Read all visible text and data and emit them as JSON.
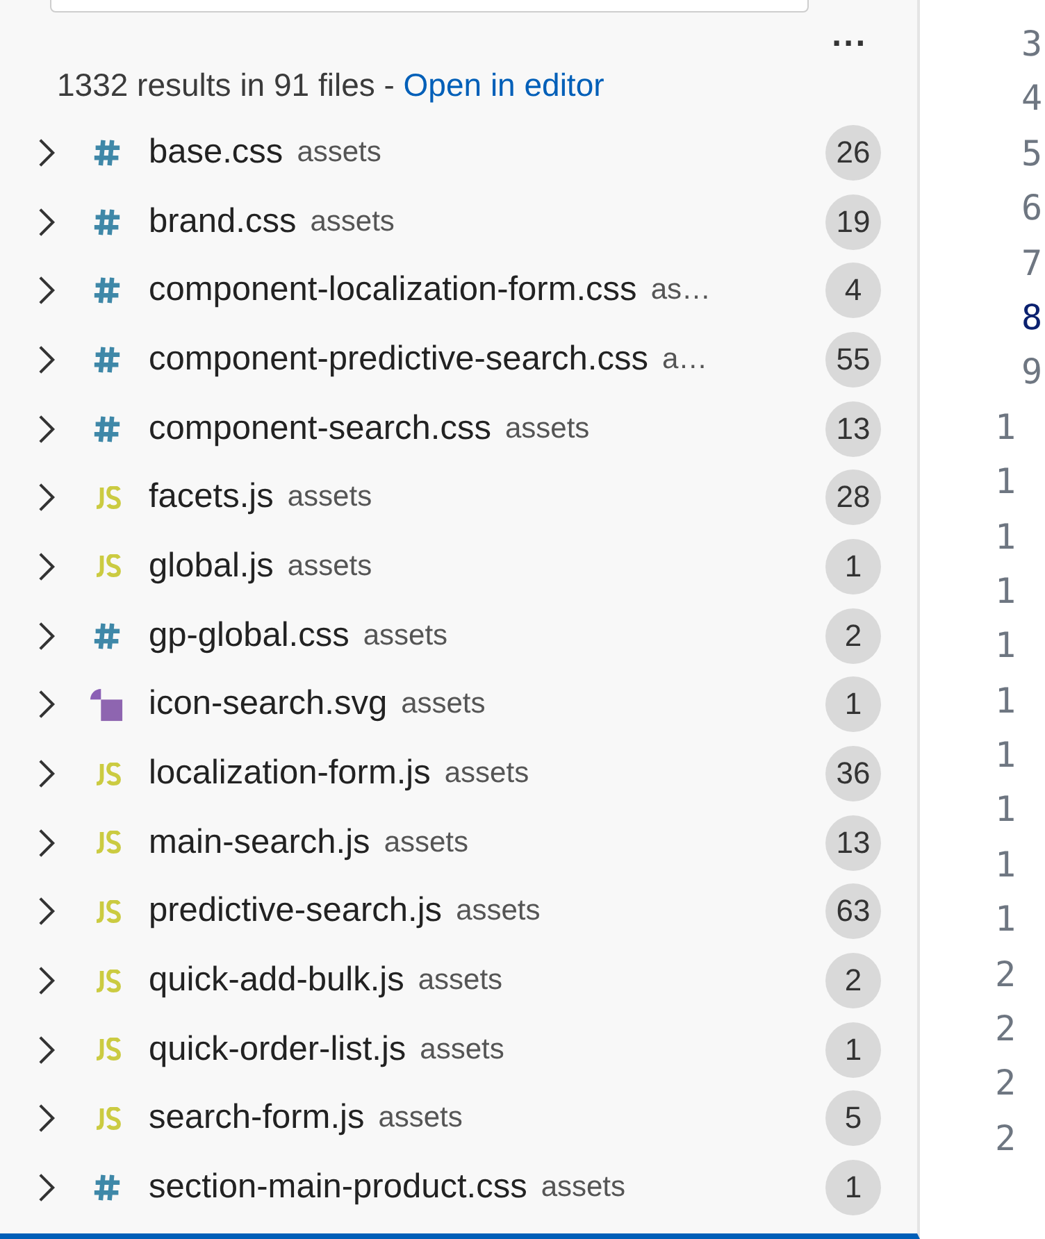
{
  "summary": {
    "text": "1332 results in 91 files - ",
    "link": "Open in editor"
  },
  "more_actions": "...",
  "results": [
    {
      "kind": "css",
      "name": "base.css",
      "folder": "assets",
      "count": "26"
    },
    {
      "kind": "css",
      "name": "brand.css",
      "folder": "assets",
      "count": "19"
    },
    {
      "kind": "css",
      "name": "component-localization-form.css",
      "folder": "as…",
      "count": "4"
    },
    {
      "kind": "css",
      "name": "component-predictive-search.css",
      "folder": "a…",
      "count": "55"
    },
    {
      "kind": "css",
      "name": "component-search.css",
      "folder": "assets",
      "count": "13"
    },
    {
      "kind": "js",
      "name": "facets.js",
      "folder": "assets",
      "count": "28"
    },
    {
      "kind": "js",
      "name": "global.js",
      "folder": "assets",
      "count": "1"
    },
    {
      "kind": "css",
      "name": "gp-global.css",
      "folder": "assets",
      "count": "2"
    },
    {
      "kind": "svg",
      "name": "icon-search.svg",
      "folder": "assets",
      "count": "1"
    },
    {
      "kind": "js",
      "name": "localization-form.js",
      "folder": "assets",
      "count": "36"
    },
    {
      "kind": "js",
      "name": "main-search.js",
      "folder": "assets",
      "count": "13"
    },
    {
      "kind": "js",
      "name": "predictive-search.js",
      "folder": "assets",
      "count": "63"
    },
    {
      "kind": "js",
      "name": "quick-add-bulk.js",
      "folder": "assets",
      "count": "2"
    },
    {
      "kind": "js",
      "name": "quick-order-list.js",
      "folder": "assets",
      "count": "1"
    },
    {
      "kind": "js",
      "name": "search-form.js",
      "folder": "assets",
      "count": "5"
    },
    {
      "kind": "css",
      "name": "section-main-product.css",
      "folder": "assets",
      "count": "1"
    }
  ],
  "editor_gutter": [
    {
      "text": "3",
      "cut": false,
      "current": false
    },
    {
      "text": "4",
      "cut": false,
      "current": false
    },
    {
      "text": "5",
      "cut": false,
      "current": false
    },
    {
      "text": "6",
      "cut": false,
      "current": false
    },
    {
      "text": "7",
      "cut": false,
      "current": false
    },
    {
      "text": "8",
      "cut": false,
      "current": true
    },
    {
      "text": "9",
      "cut": false,
      "current": false
    },
    {
      "text": "1",
      "cut": true,
      "current": false
    },
    {
      "text": "1",
      "cut": true,
      "current": false
    },
    {
      "text": "1",
      "cut": true,
      "current": false
    },
    {
      "text": "1",
      "cut": true,
      "current": false
    },
    {
      "text": "1",
      "cut": true,
      "current": false
    },
    {
      "text": "1",
      "cut": true,
      "current": false
    },
    {
      "text": "1",
      "cut": true,
      "current": false
    },
    {
      "text": "1",
      "cut": true,
      "current": false
    },
    {
      "text": "1",
      "cut": true,
      "current": false
    },
    {
      "text": "1",
      "cut": true,
      "current": false
    },
    {
      "text": "2",
      "cut": true,
      "current": false
    },
    {
      "text": "2",
      "cut": true,
      "current": false
    },
    {
      "text": "2",
      "cut": true,
      "current": false
    },
    {
      "text": "2",
      "cut": true,
      "current": false
    }
  ]
}
